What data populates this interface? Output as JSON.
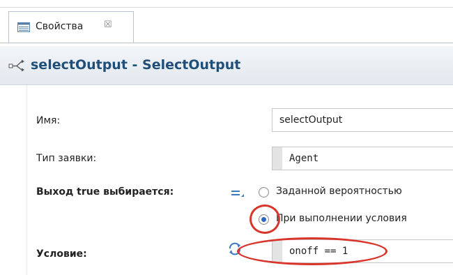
{
  "tab": {
    "label": "Свойства",
    "close_glyph": "☒",
    "icon": "properties-grid-icon"
  },
  "header": {
    "title": "selectOutput - SelectOutput",
    "icon": "select-output-icon",
    "title_color": "#1f4e79"
  },
  "form": {
    "name": {
      "label": "Имя:",
      "value": "selectOutput"
    },
    "agent_type": {
      "label": "Тип заявки:",
      "value": "Agent"
    },
    "selection": {
      "label": "Выход true выбирается:",
      "options": [
        {
          "label": "Заданной вероятностью",
          "checked": false
        },
        {
          "label": "При выполнении условия",
          "checked": true
        }
      ]
    },
    "condition": {
      "label": "Условие:",
      "value": "onoff == 1"
    }
  },
  "annotations": {
    "highlight_color": "#d9352b"
  }
}
